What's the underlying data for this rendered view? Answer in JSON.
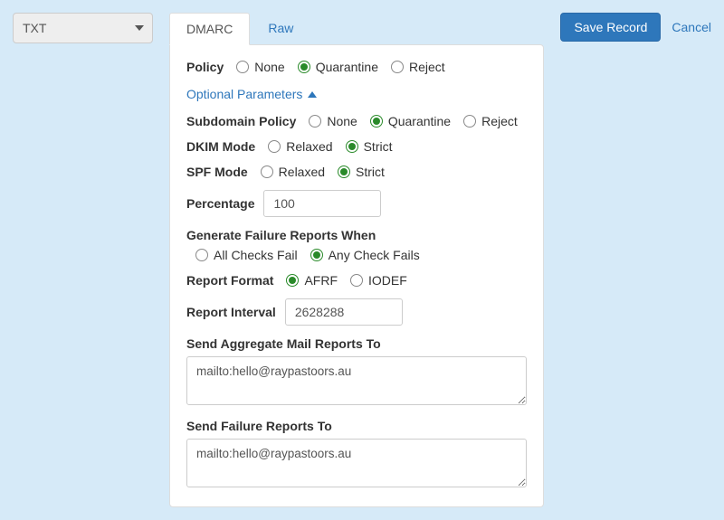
{
  "record_type": {
    "value": "TXT"
  },
  "actions": {
    "save": "Save Record",
    "cancel": "Cancel"
  },
  "tabs": {
    "dmarc": "DMARC",
    "raw": "Raw"
  },
  "policy": {
    "label": "Policy",
    "options": {
      "none": "None",
      "quarantine": "Quarantine",
      "reject": "Reject"
    },
    "selected": "quarantine"
  },
  "optional_toggle": "Optional Parameters",
  "subdomain_policy": {
    "label": "Subdomain Policy",
    "options": {
      "none": "None",
      "quarantine": "Quarantine",
      "reject": "Reject"
    },
    "selected": "quarantine"
  },
  "dkim_mode": {
    "label": "DKIM Mode",
    "options": {
      "relaxed": "Relaxed",
      "strict": "Strict"
    },
    "selected": "strict"
  },
  "spf_mode": {
    "label": "SPF Mode",
    "options": {
      "relaxed": "Relaxed",
      "strict": "Strict"
    },
    "selected": "strict"
  },
  "percentage": {
    "label": "Percentage",
    "value": "100"
  },
  "failure_reports": {
    "label": "Generate Failure Reports When",
    "options": {
      "all": "All Checks Fail",
      "any": "Any Check Fails"
    },
    "selected": "any"
  },
  "report_format": {
    "label": "Report Format",
    "options": {
      "afrf": "AFRF",
      "iodef": "IODEF"
    },
    "selected": "afrf"
  },
  "report_interval": {
    "label": "Report Interval",
    "value": "2628288"
  },
  "aggregate_reports": {
    "label": "Send Aggregate Mail Reports To",
    "value": "mailto:hello@raypastoors.au"
  },
  "failure_reports_to": {
    "label": "Send Failure Reports To",
    "value": "mailto:hello@raypastoors.au"
  }
}
